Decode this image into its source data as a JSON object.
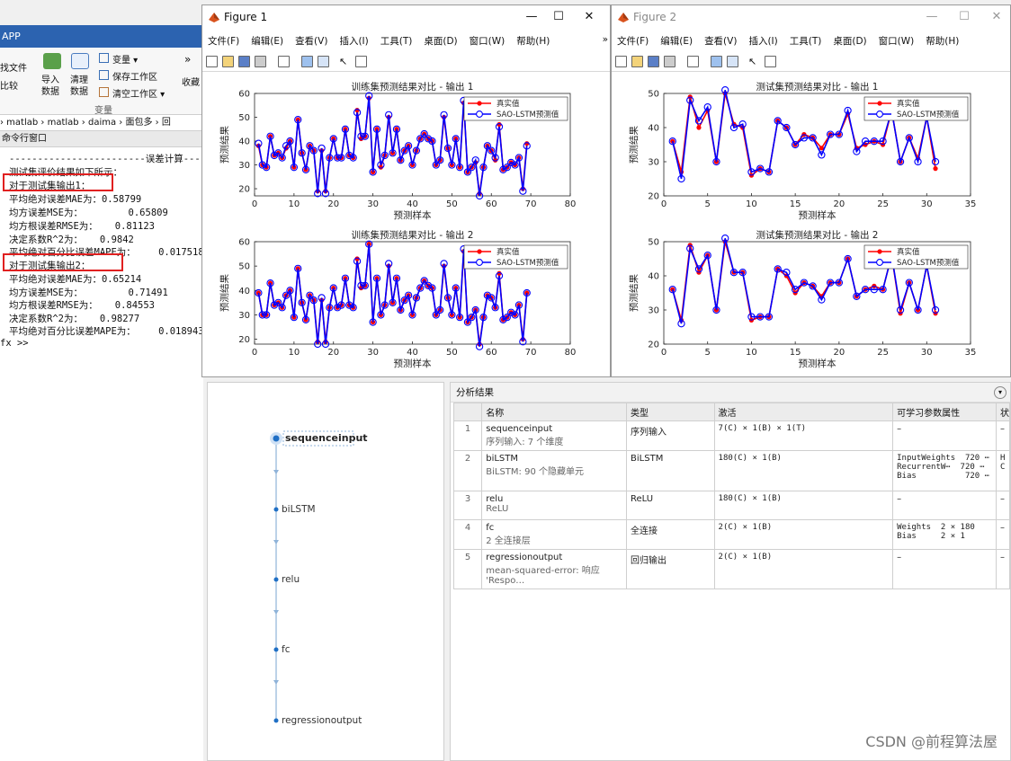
{
  "matlab": {
    "title": "APP",
    "ribbon": {
      "find_files": "找文件",
      "compare": "比较",
      "import_data": "导入\n数据",
      "clean_data": "清理\n数据",
      "variable": "变量 ▾",
      "save_workspace": "保存工作区",
      "clear_workspace": "清空工作区 ▾",
      "favorites": "收藏",
      "section_variable": "变量",
      "overflow": "»"
    },
    "breadcrumb": "› matlab › matlab › daima › 面包多 › 回",
    "cmd_window_title": "命令行窗口",
    "cmd_lines": [
      "------------------------误差计算----",
      "测试集评价结果如下所示：",
      "对于测试集输出1：",
      "平均绝对误差MAE为：0.58799",
      "均方误差MSE为：        0.65809",
      "均方根误差RMSE为：   0.81123",
      "决定系数R^2为：   0.9842",
      "平均绝对百分比误差MAPE为：    0.017518",
      "对于测试集输出2：",
      "平均绝对误差MAE为：0.65214",
      "均方误差MSE为：        0.71491",
      "均方根误差RMSE为：   0.84553",
      "决定系数R^2为：   0.98277",
      "平均绝对百分比误差MAPE为：    0.018943"
    ],
    "prompt": "fx >>"
  },
  "figure1": {
    "title": "Figure 1",
    "menu": [
      "文件(F)",
      "编辑(E)",
      "查看(V)",
      "插入(I)",
      "工具(T)",
      "桌面(D)",
      "窗口(W)",
      "帮助(H)"
    ],
    "overflow": "»",
    "top_title": "训练集预测结果对比 - 输出 1",
    "bottom_title": "训练集预测结果对比 - 输出 2",
    "xlabel": "预测样本",
    "ylabel": "预测结果"
  },
  "figure2": {
    "title": "Figure 2",
    "menu": [
      "文件(F)",
      "编辑(E)",
      "查看(V)",
      "插入(I)",
      "工具(T)",
      "桌面(D)",
      "窗口(W)",
      "帮助(H)"
    ],
    "top_title": "测试集预测结果对比 - 输出 1",
    "bottom_title": "测试集预测结果对比 - 输出 2",
    "xlabel": "预测样本",
    "ylabel": "预测结果"
  },
  "legend": {
    "true": "真实值",
    "pred": "SAO-LSTM预测值"
  },
  "colors": {
    "true": "#ff0000",
    "pred": "#0000ff",
    "marker_face": "#7b22a8"
  },
  "chart_data": [
    {
      "type": "line",
      "title": "训练集预测结果对比 - 输出 1",
      "xlabel": "预测样本",
      "ylabel": "预测结果",
      "xlim": [
        0,
        80
      ],
      "ylim": [
        17,
        60
      ],
      "xticks": [
        0,
        10,
        20,
        30,
        40,
        50,
        60,
        70,
        80
      ],
      "yticks": [
        20,
        30,
        40,
        50,
        60
      ],
      "legend_position": "top-right",
      "series": [
        {
          "name": "真实值",
          "values": [
            38,
            30,
            29,
            42,
            34,
            35,
            33,
            37,
            40,
            29,
            49,
            35,
            28,
            38,
            36,
            19,
            36,
            19,
            33,
            41,
            33,
            33,
            45,
            34,
            33,
            53,
            41,
            42,
            58,
            27,
            45,
            29,
            34,
            50,
            35,
            45,
            32,
            36,
            38,
            30,
            36,
            41,
            43,
            41,
            40,
            30,
            32,
            50,
            37,
            30,
            41,
            29,
            56,
            27,
            29,
            31,
            18,
            29,
            38,
            36,
            32,
            47,
            28,
            29,
            31,
            30,
            33,
            20,
            39
          ]
        },
        {
          "name": "SAO-LSTM预测值",
          "values": [
            39,
            30,
            29,
            42,
            34,
            35,
            33,
            38,
            40,
            29,
            49,
            35,
            28,
            38,
            36,
            18,
            37,
            18,
            33,
            41,
            33,
            33,
            45,
            34,
            33,
            52,
            42,
            42,
            59,
            27,
            45,
            30,
            34,
            51,
            35,
            45,
            32,
            36,
            38,
            30,
            36,
            41,
            43,
            41,
            40,
            30,
            32,
            51,
            37,
            30,
            41,
            29,
            57,
            27,
            29,
            32,
            17,
            29,
            38,
            36,
            33,
            46,
            28,
            29,
            31,
            30,
            33,
            19,
            38
          ]
        }
      ],
      "x": [
        1,
        2,
        3,
        4,
        5,
        6,
        7,
        8,
        9,
        10,
        11,
        12,
        13,
        14,
        15,
        16,
        17,
        18,
        19,
        20,
        21,
        22,
        23,
        24,
        25,
        26,
        27,
        28,
        29,
        30,
        31,
        32,
        33,
        34,
        35,
        36,
        37,
        38,
        39,
        40,
        41,
        42,
        43,
        44,
        45,
        46,
        47,
        48,
        49,
        50,
        51,
        52,
        53,
        54,
        55,
        56,
        57,
        58,
        59,
        60,
        61,
        62,
        63,
        64,
        65,
        66,
        67,
        68,
        69
      ]
    },
    {
      "type": "line",
      "title": "训练集预测结果对比 - 输出 2",
      "xlabel": "预测样本",
      "ylabel": "预测结果",
      "xlim": [
        0,
        80
      ],
      "ylim": [
        18,
        60
      ],
      "xticks": [
        0,
        10,
        20,
        30,
        40,
        50,
        60,
        70,
        80
      ],
      "yticks": [
        20,
        30,
        40,
        50,
        60
      ],
      "legend_position": "top-right",
      "series": [
        {
          "name": "真实值",
          "values": [
            39,
            30,
            30,
            43,
            34,
            35,
            33,
            38,
            40,
            29,
            49,
            35,
            28,
            38,
            36,
            19,
            36,
            19,
            33,
            41,
            33,
            34,
            45,
            34,
            33,
            53,
            41,
            42,
            59,
            27,
            45,
            30,
            34,
            50,
            35,
            45,
            32,
            36,
            38,
            30,
            37,
            41,
            44,
            42,
            41,
            30,
            32,
            50,
            37,
            30,
            41,
            29,
            56,
            27,
            29,
            32,
            18,
            29,
            38,
            37,
            33,
            47,
            28,
            29,
            31,
            30,
            34,
            20,
            39
          ]
        },
        {
          "name": "SAO-LSTM预测值",
          "values": [
            39,
            30,
            30,
            43,
            34,
            35,
            33,
            38,
            40,
            29,
            49,
            35,
            28,
            38,
            36,
            18,
            37,
            18,
            33,
            41,
            33,
            34,
            45,
            34,
            33,
            52,
            42,
            42,
            59,
            27,
            45,
            30,
            34,
            51,
            35,
            45,
            32,
            36,
            38,
            30,
            37,
            41,
            44,
            42,
            41,
            30,
            32,
            51,
            37,
            30,
            41,
            29,
            57,
            27,
            29,
            32,
            17,
            29,
            38,
            37,
            33,
            46,
            28,
            29,
            31,
            30,
            34,
            19,
            39
          ]
        }
      ],
      "x": [
        1,
        2,
        3,
        4,
        5,
        6,
        7,
        8,
        9,
        10,
        11,
        12,
        13,
        14,
        15,
        16,
        17,
        18,
        19,
        20,
        21,
        22,
        23,
        24,
        25,
        26,
        27,
        28,
        29,
        30,
        31,
        32,
        33,
        34,
        35,
        36,
        37,
        38,
        39,
        40,
        41,
        42,
        43,
        44,
        45,
        46,
        47,
        48,
        49,
        50,
        51,
        52,
        53,
        54,
        55,
        56,
        57,
        58,
        59,
        60,
        61,
        62,
        63,
        64,
        65,
        66,
        67,
        68,
        69
      ]
    },
    {
      "type": "line",
      "title": "测试集预测结果对比 - 输出 1",
      "xlabel": "预测样本",
      "ylabel": "预测结果",
      "xlim": [
        0,
        35
      ],
      "ylim": [
        20,
        50
      ],
      "xticks": [
        0,
        5,
        10,
        15,
        20,
        25,
        30,
        35
      ],
      "yticks": [
        20,
        30,
        40,
        50
      ],
      "legend_position": "top-right",
      "series": [
        {
          "name": "真实值",
          "values": [
            36,
            27,
            49,
            40,
            45,
            30,
            50,
            41,
            40,
            26,
            28,
            27,
            42,
            40,
            35,
            38,
            37,
            34,
            38,
            38,
            44,
            34,
            35,
            36,
            35,
            45,
            30,
            37,
            31,
            43,
            28
          ]
        },
        {
          "name": "SAO-LSTM预测值",
          "values": [
            36,
            25,
            48,
            42,
            46,
            30,
            51,
            40,
            41,
            27,
            28,
            27,
            42,
            40,
            35,
            37,
            37,
            32,
            38,
            38,
            45,
            33,
            36,
            36,
            36,
            45,
            30,
            37,
            30,
            43,
            30
          ]
        }
      ],
      "x": [
        1,
        2,
        3,
        4,
        5,
        6,
        7,
        8,
        9,
        10,
        11,
        12,
        13,
        14,
        15,
        16,
        17,
        18,
        19,
        20,
        21,
        22,
        23,
        24,
        25,
        26,
        27,
        28,
        29,
        30,
        31
      ]
    },
    {
      "type": "line",
      "title": "测试集预测结果对比 - 输出 2",
      "xlabel": "预测样本",
      "ylabel": "预测结果",
      "xlim": [
        0,
        35
      ],
      "ylim": [
        20,
        50
      ],
      "xticks": [
        0,
        5,
        10,
        15,
        20,
        25,
        30,
        35
      ],
      "yticks": [
        20,
        30,
        40,
        50
      ],
      "legend_position": "top-right",
      "series": [
        {
          "name": "真实值",
          "values": [
            36,
            27,
            49,
            41,
            46,
            30,
            50,
            41,
            41,
            27,
            28,
            28,
            42,
            40,
            35,
            38,
            37,
            34,
            38,
            38,
            45,
            34,
            36,
            37,
            36,
            46,
            29,
            38,
            30,
            43,
            29
          ]
        },
        {
          "name": "SAO-LSTM预测值",
          "values": [
            36,
            26,
            48,
            42,
            46,
            30,
            51,
            41,
            41,
            28,
            28,
            28,
            42,
            41,
            36,
            38,
            37,
            33,
            38,
            38,
            45,
            34,
            36,
            36,
            36,
            46,
            30,
            38,
            30,
            43,
            30
          ]
        }
      ],
      "x": [
        1,
        2,
        3,
        4,
        5,
        6,
        7,
        8,
        9,
        10,
        11,
        12,
        13,
        14,
        15,
        16,
        17,
        18,
        19,
        20,
        21,
        22,
        23,
        24,
        25,
        26,
        27,
        28,
        29,
        30,
        31
      ]
    }
  ],
  "network": {
    "layers": [
      "sequenceinput",
      "biLSTM",
      "relu",
      "fc",
      "regressionoutput"
    ]
  },
  "analysis": {
    "title": "分析结果",
    "headers": [
      "",
      "名称",
      "类型",
      "激活",
      "可学习参数属性",
      "状"
    ],
    "rows": [
      {
        "idx": "1",
        "name": "sequenceinput",
        "desc": "序列输入: 7 个维度",
        "type": "序列输入",
        "act": "7(C) × 1(B) × 1(T)",
        "params": "–",
        "state": "–"
      },
      {
        "idx": "2",
        "name": "biLSTM",
        "desc": "BiLSTM: 90 个隐藏单元",
        "type": "BiLSTM",
        "act": "180(C) × 1(B)",
        "params": "InputWeights  720 ⋯\nRecurrentW⋯  720 ⋯\nBias          720 ⋯",
        "state": "H\nC"
      },
      {
        "idx": "3",
        "name": "relu",
        "desc": "ReLU",
        "type": "ReLU",
        "act": "180(C) × 1(B)",
        "params": "–",
        "state": "–"
      },
      {
        "idx": "4",
        "name": "fc",
        "desc": "2 全连接层",
        "type": "全连接",
        "act": "2(C) × 1(B)",
        "params": "Weights  2 × 180\nBias     2 × 1",
        "state": "–"
      },
      {
        "idx": "5",
        "name": "regressionoutput",
        "desc": "mean-squared-error: 响应 'Respo…",
        "type": "回归输出",
        "act": "2(C) × 1(B)",
        "params": "–",
        "state": "–"
      }
    ]
  },
  "watermark": "CSDN @前程算法屋"
}
